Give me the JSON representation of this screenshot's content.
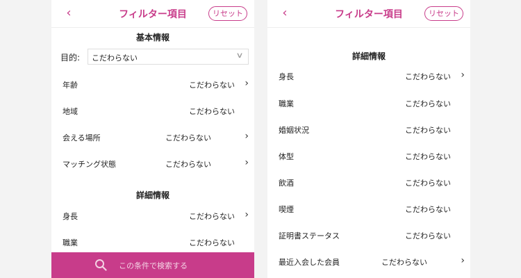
{
  "left": {
    "header": {
      "title": "フィルター項目",
      "reset": "リセット"
    },
    "basic": {
      "title": "基本情報",
      "purpose_label": "目的:",
      "purpose_value": "こだわらない",
      "rows": [
        {
          "label": "年齢",
          "value": "こだわらない",
          "chevron": true
        },
        {
          "label": "地域",
          "value": "こだわらない",
          "chevron": false
        },
        {
          "label": "会える場所",
          "value": "こだわらない",
          "chevron": true
        },
        {
          "label": "マッチング状態",
          "value": "こだわらない",
          "chevron": true
        }
      ]
    },
    "detail": {
      "title": "詳細情報",
      "rows": [
        {
          "label": "身長",
          "value": "こだわらない",
          "chevron": true
        },
        {
          "label": "職業",
          "value": "こだわらない",
          "chevron": false
        }
      ]
    },
    "search_button": "この条件で検索する"
  },
  "right": {
    "header": {
      "title": "フィルター項目",
      "reset": "リセット"
    },
    "detail": {
      "title": "詳細情報",
      "rows": [
        {
          "label": "身長",
          "value": "こだわらない",
          "chevron": true
        },
        {
          "label": "職業",
          "value": "こだわらない",
          "chevron": false
        },
        {
          "label": "婚姻状況",
          "value": "こだわらない",
          "chevron": false
        },
        {
          "label": "体型",
          "value": "こだわらない",
          "chevron": false
        },
        {
          "label": "飲酒",
          "value": "こだわらない",
          "chevron": false
        },
        {
          "label": "喫煙",
          "value": "こだわらない",
          "chevron": false
        },
        {
          "label": "証明書ステータス",
          "value": "こだわらない",
          "chevron": false
        },
        {
          "label": "最近入会した会員",
          "value": "こだわらない",
          "chevron": true
        }
      ]
    }
  },
  "icons": {
    "back": "back-chevron-icon",
    "row": "chevron-right-icon",
    "select": "chevron-down-icon",
    "search": "search-icon"
  },
  "colors": {
    "accent": "#c83c8a",
    "search_text": "#f4d2e4",
    "page_background": "#f3f3f3"
  }
}
